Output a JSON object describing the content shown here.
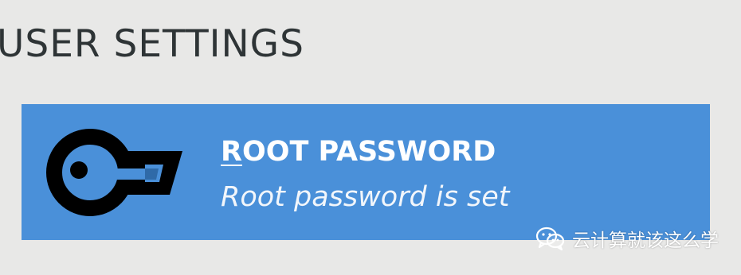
{
  "section": {
    "title": "USER SETTINGS"
  },
  "root_password_spoke": {
    "title_mnemonic": "R",
    "title_rest": "OOT PASSWORD",
    "status": "Root password is set",
    "icon": "key-icon",
    "background_color": "#4a90d9"
  },
  "watermark": {
    "icon": "wechat-icon",
    "text": "云计算就该这么学"
  }
}
